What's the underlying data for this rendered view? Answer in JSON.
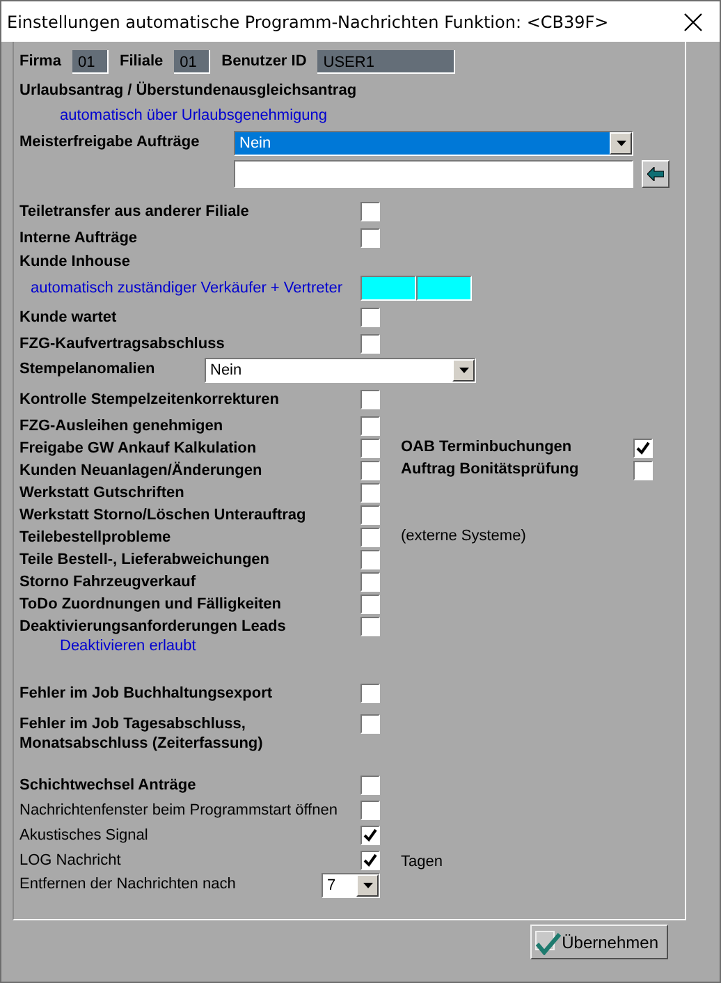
{
  "window": {
    "title": "Einstellungen automatische Programm-Nachrichten Funktion: <CB39F>"
  },
  "groups": [
    {
      "rows": [
        {
          "kind": "ids",
          "fields": [
            {
              "label": "Firma",
              "value": "01"
            },
            {
              "label": "Filiale",
              "value": "01"
            },
            {
              "label": "Benutzer ID",
              "value": "USER1"
            }
          ]
        },
        {
          "kind": "heading",
          "label": "Urlaubsantrag / Überstundenausgleichsantrag"
        },
        {
          "kind": "note",
          "text": "automatisch über Urlaubsgenehmigung"
        },
        {
          "kind": "select_input",
          "label": "Meisterfreigabe Aufträge",
          "value": "Nein",
          "selected": true,
          "bold": true
        }
      ]
    },
    {
      "rows": [
        {
          "kind": "checkbox",
          "label": "Teiletransfer aus anderer Filiale",
          "bold": true,
          "checked": false
        },
        {
          "kind": "checkbox",
          "label": "Interne Aufträge",
          "bold": true,
          "checked": false
        },
        {
          "kind": "heading",
          "label": "Kunde Inhouse"
        },
        {
          "kind": "note_fields",
          "text": "automatisch zuständiger Verkäufer +  Vertreter"
        },
        {
          "kind": "checkbox",
          "label": "Kunde wartet",
          "bold": true,
          "checked": false
        },
        {
          "kind": "checkbox",
          "label": "FZG-Kaufvertragsabschluss",
          "bold": true,
          "checked": false
        },
        {
          "kind": "select",
          "label": "Stempelanomalien",
          "value": "Nein",
          "selected": false,
          "bold": true
        },
        {
          "kind": "checkbox",
          "label": "Kontrolle Stempelzeitenkorrekturen",
          "bold": true,
          "checked": false
        },
        {
          "kind": "checkbox",
          "label": "FZG-Ausleihen genehmigen",
          "bold": true,
          "checked": false
        }
      ]
    },
    {
      "rows": [
        {
          "kind": "checkbox",
          "label": "Freigabe GW Ankauf Kalkulation",
          "bold": true,
          "checked": false,
          "side": {
            "label": "OAB Terminbuchungen",
            "checked": true
          }
        },
        {
          "kind": "checkbox",
          "label": "Kunden Neuanlagen/Änderungen",
          "bold": true,
          "checked": false,
          "side": {
            "label": "Auftrag Bonitätsprüfung",
            "checked": false
          }
        },
        {
          "kind": "checkbox",
          "label": "Werkstatt Gutschriften",
          "bold": true,
          "checked": false
        },
        {
          "kind": "checkbox",
          "label": "Werkstatt Storno/Löschen Unterauftrag",
          "bold": true,
          "checked": false
        },
        {
          "kind": "checkbox",
          "label": "Teilebestellprobleme",
          "bold": true,
          "checked": false,
          "aside": "(externe Systeme)"
        },
        {
          "kind": "checkbox",
          "label": "Teile Bestell-, Lieferabweichungen",
          "bold": true,
          "checked": false
        },
        {
          "kind": "checkbox",
          "label": "Storno Fahrzeugverkauf",
          "bold": true,
          "checked": false
        },
        {
          "kind": "checkbox",
          "label": "ToDo Zuordnungen und Fälligkeiten",
          "bold": true,
          "checked": false
        },
        {
          "kind": "checkbox",
          "label": "Deaktivierungsanforderungen Leads",
          "bold": true,
          "checked": false
        },
        {
          "kind": "note",
          "text": "Deaktivieren erlaubt"
        }
      ]
    },
    {
      "rows": [
        {
          "kind": "checkbox",
          "label": "Fehler im Job Buchhaltungsexport",
          "bold": true,
          "checked": false
        },
        {
          "kind": "checkbox",
          "label": "Fehler im Job Tagesabschluss, Monatsabschluss (Zeiterfassung)",
          "bold": true,
          "checked": false
        }
      ]
    },
    {
      "rows": [
        {
          "kind": "checkbox",
          "label": "Schichtwechsel Anträge",
          "bold": true,
          "checked": false
        },
        {
          "kind": "checkbox",
          "label": "Nachrichtenfenster beim Programmstart öffnen",
          "bold": false,
          "checked": false
        },
        {
          "kind": "checkbox",
          "label": "Akustisches Signal",
          "bold": false,
          "checked": true
        },
        {
          "kind": "checkbox",
          "label": "LOG Nachricht",
          "bold": false,
          "checked": true,
          "aside": "Tagen"
        },
        {
          "kind": "select",
          "label": "Entfernen der Nachrichten nach",
          "value": "7",
          "selected": false,
          "bold": false
        }
      ]
    }
  ],
  "apply_button": {
    "label": "Übernehmen"
  }
}
